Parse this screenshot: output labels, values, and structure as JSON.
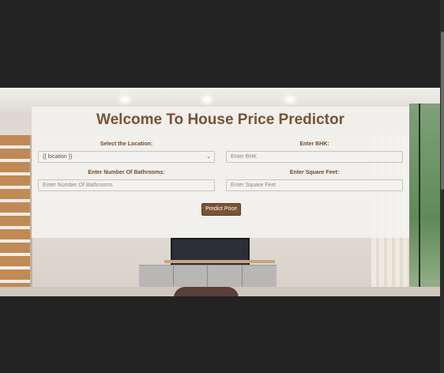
{
  "page": {
    "title": "Welcome To House Price Predictor"
  },
  "form": {
    "location": {
      "label": "Select the Location:",
      "selected_value": "{{ location }}"
    },
    "bhk": {
      "label": "Enter BHK:",
      "placeholder": "Enter BHK"
    },
    "bathrooms": {
      "label": "Enter Number Of Bathrooms:",
      "placeholder": "Enter Number Of Bathrooms"
    },
    "sqft": {
      "label": "Enter Square Feet:",
      "placeholder": "Enter Square Feet"
    },
    "submit_label": "Predict Price"
  },
  "colors": {
    "accent": "#7a5332",
    "background": "#232323"
  },
  "icons": {
    "select_caret": "chevron-down-icon"
  }
}
